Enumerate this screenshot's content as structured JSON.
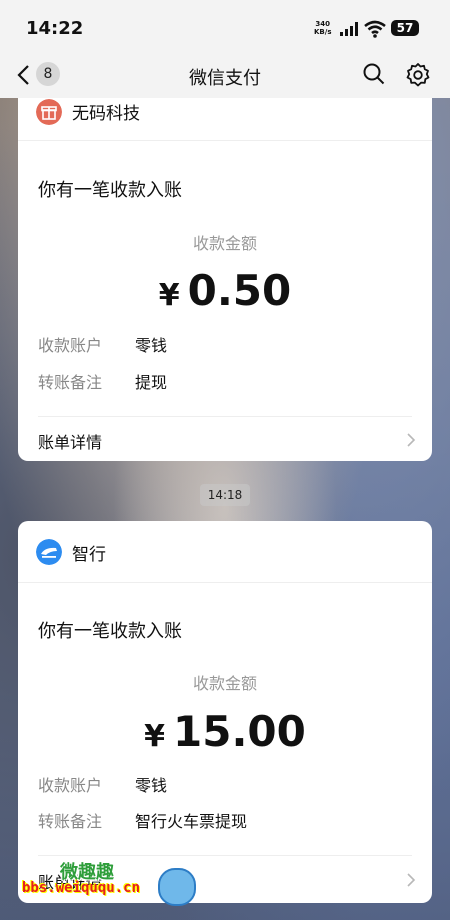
{
  "status_bar": {
    "time": "14:22",
    "net_speed_value": "340",
    "net_speed_unit": "KB/s",
    "battery": "57"
  },
  "nav": {
    "back_count": "8",
    "title": "微信支付"
  },
  "time_separator": "14:18",
  "cards": [
    {
      "merchant": "无码科技",
      "merchant_icon": "gift-icon",
      "merchant_icon_color": "#e36a57",
      "title": "你有一笔收款入账",
      "amount_label": "收款金额",
      "currency": "¥",
      "amount": "0.50",
      "rows": [
        {
          "label": "收款账户",
          "value": "零钱"
        },
        {
          "label": "转账备注",
          "value": "提现"
        }
      ],
      "details_label": "账单详情"
    },
    {
      "merchant": "智行",
      "merchant_icon": "train-icon",
      "merchant_icon_color": "#2d8cf0",
      "title": "你有一笔收款入账",
      "amount_label": "收款金额",
      "currency": "¥",
      "amount": "15.00",
      "rows": [
        {
          "label": "收款账户",
          "value": "零钱"
        },
        {
          "label": "转账备注",
          "value": "智行火车票提现"
        }
      ],
      "details_label": "账单详情"
    }
  ],
  "watermark": {
    "logo": "微趣趣",
    "url": "bbs.weiququ.cn"
  }
}
